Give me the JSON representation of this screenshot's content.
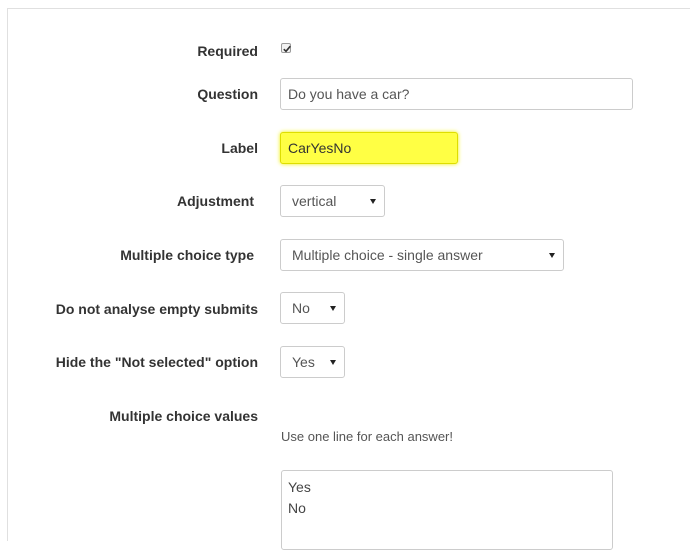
{
  "form": {
    "required": {
      "label": "Required",
      "checked": true
    },
    "question": {
      "label": "Question",
      "value": "Do you have a car?"
    },
    "label_field": {
      "label": "Label",
      "value": "CarYesNo",
      "highlight_color": "#ffff44"
    },
    "adjustment": {
      "label": "Adjustment",
      "selected": "vertical"
    },
    "multiple_choice_type": {
      "label": "Multiple choice type",
      "selected": "Multiple choice - single answer"
    },
    "empty_submits": {
      "label": "Do not analyse empty submits",
      "selected": "No"
    },
    "hide_not_selected": {
      "label": "Hide the \"Not selected\" option",
      "selected": "Yes"
    },
    "values": {
      "label": "Multiple choice values",
      "hint": "Use one line for each answer!",
      "text": "Yes\nNo"
    }
  }
}
